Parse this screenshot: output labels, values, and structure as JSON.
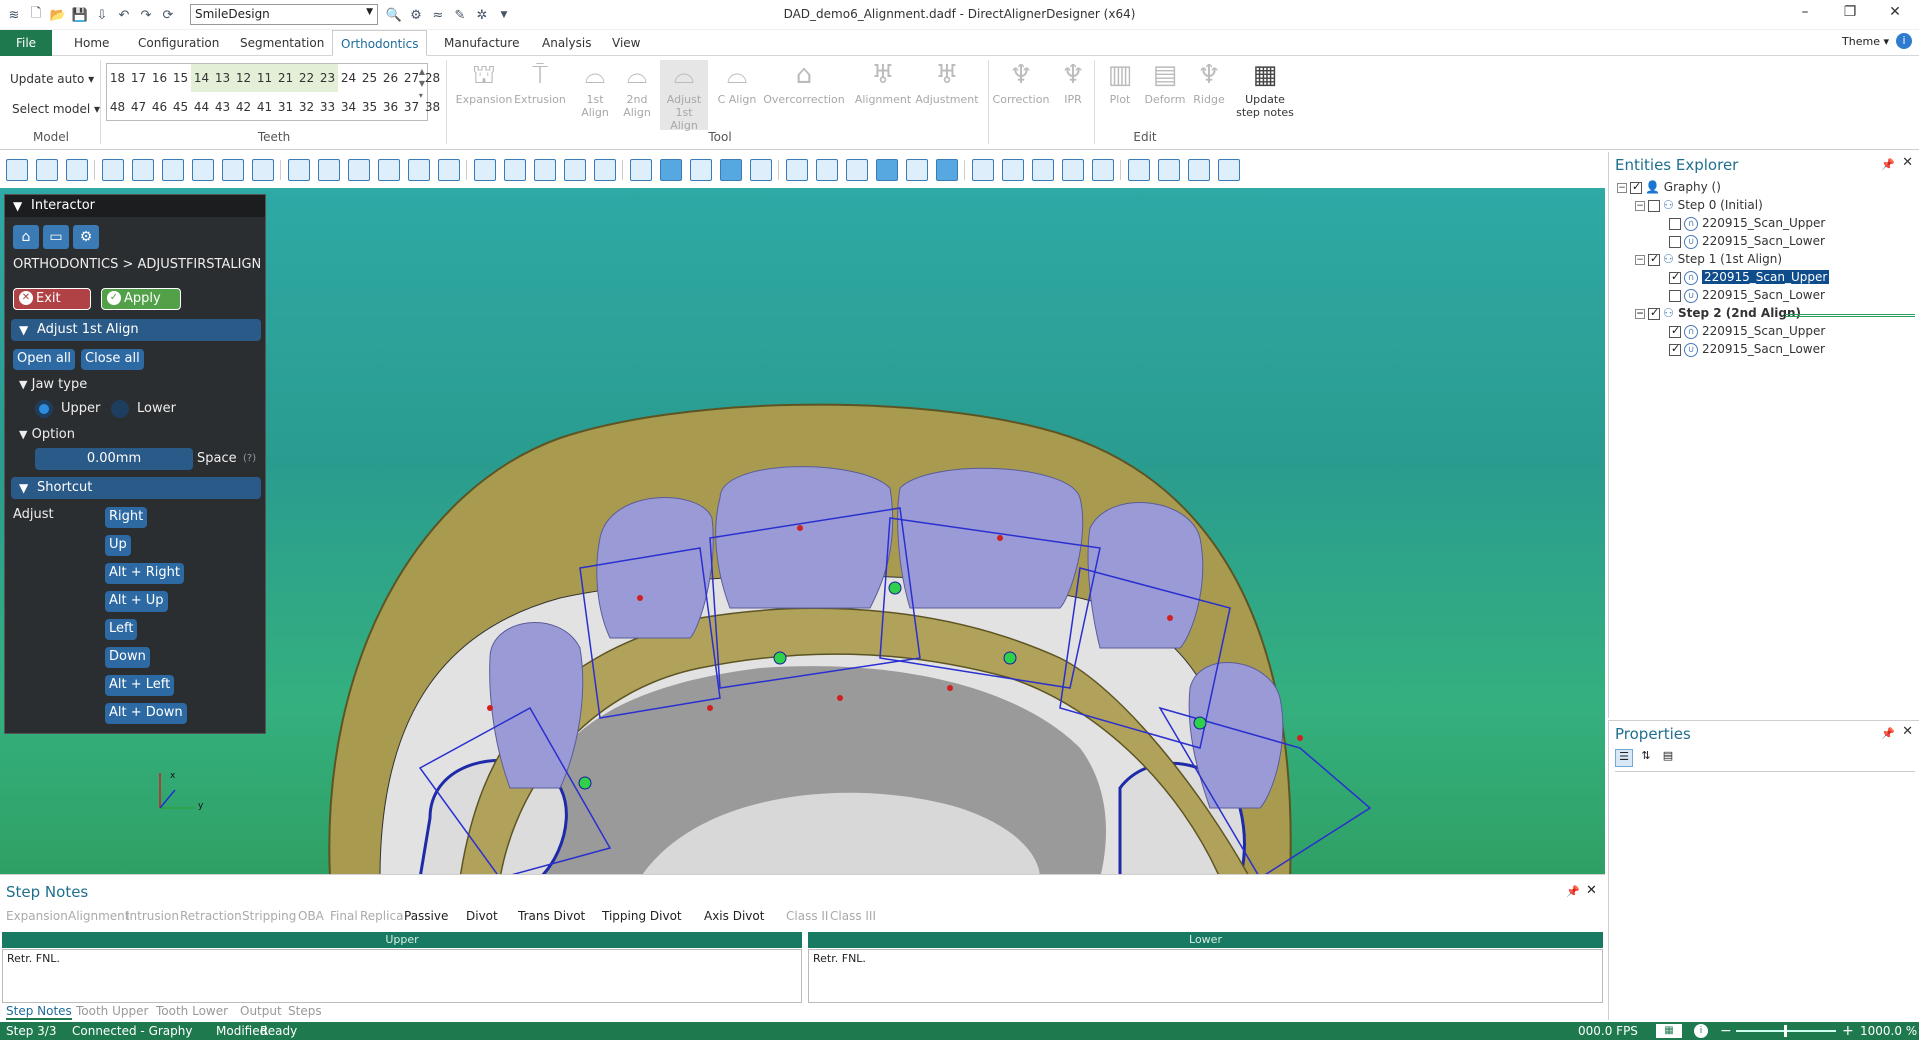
{
  "window": {
    "title": "DAD_demo6_Alignment.dadf - DirectAlignerDesigner (x64)",
    "profile": "SmileDesign",
    "theme": "Theme"
  },
  "menu": [
    "File",
    "Home",
    "Configuration",
    "Segmentation",
    "Orthodontics",
    "Manufacture",
    "Analysis",
    "View"
  ],
  "ribbon": {
    "model": {
      "update": "Update auto",
      "select": "Select model",
      "label": "Model"
    },
    "teeth": {
      "upper": [
        "18",
        "17",
        "16",
        "15",
        "14",
        "13",
        "12",
        "11",
        "21",
        "22",
        "23",
        "24",
        "25",
        "26",
        "27",
        "28"
      ],
      "lower": [
        "48",
        "47",
        "46",
        "45",
        "44",
        "43",
        "42",
        "41",
        "31",
        "32",
        "33",
        "34",
        "35",
        "36",
        "37",
        "38"
      ],
      "label": "Teeth"
    },
    "tools": [
      {
        "label": "Expansion"
      },
      {
        "label": "Extrusion"
      },
      {
        "label": "1st Align"
      },
      {
        "label": "2nd Align"
      },
      {
        "label": "Adjust 1st Align"
      },
      {
        "label": "C Align"
      },
      {
        "label": "Overcorrection"
      },
      {
        "label": "Alignment"
      },
      {
        "label": "Adjustment"
      }
    ],
    "tool_label": "Tool",
    "edit": [
      {
        "label": "Correction"
      },
      {
        "label": "IPR"
      },
      {
        "label": "Plot"
      },
      {
        "label": "Deform"
      },
      {
        "label": "Ridge"
      }
    ],
    "update_notes": "Update step notes",
    "edit_label": "Edit"
  },
  "interactor": {
    "title": "Interactor",
    "breadcrumb": "ORTHODONTICS > ADJUSTFIRSTALIGN",
    "exit": "Exit",
    "apply": "Apply",
    "section_adjust": "Adjust 1st Align",
    "open_all": "Open all",
    "close_all": "Close all",
    "jaw_type": "Jaw type",
    "upper": "Upper",
    "lower": "Lower",
    "option": "Option",
    "space_value": "0.00mm",
    "space_label": "Space",
    "help": "(?)",
    "shortcut": "Shortcut",
    "adjust_label": "Adjust",
    "shortcuts": [
      "Right",
      "Up",
      "Alt + Right",
      "Alt + Up",
      "Left",
      "Down",
      "Alt + Left",
      "Alt + Down"
    ]
  },
  "entities": {
    "title": "Entities Explorer",
    "root": "Graphy ()",
    "steps": [
      {
        "name": "Step 0 (Initial)",
        "items": [
          "220915_Scan_Upper",
          "220915_Sacn_Lower"
        ]
      },
      {
        "name": "Step 1 (1st Align)",
        "items": [
          "220915_Scan_Upper",
          "220915_Sacn_Lower"
        ]
      },
      {
        "name": "Step 2 (2nd Align)",
        "items": [
          "220915_Scan_Upper",
          "220915_Sacn_Lower"
        ]
      }
    ]
  },
  "properties": {
    "title": "Properties"
  },
  "stepnotes": {
    "title": "Step Notes",
    "chips": [
      "Expansion",
      "Alignment",
      "Intrusion",
      "Retraction",
      "Stripping",
      "OBA",
      "Final",
      "Replica",
      "Passive",
      "Divot",
      "Trans Divot",
      "Tipping Divot",
      "Axis Divot",
      "Class II",
      "Class III"
    ],
    "upper_head": "Upper",
    "lower_head": "Lower",
    "upper_text": "Retr. FNL.",
    "lower_text": "Retr. FNL.",
    "tabs": [
      "Step Notes",
      "Tooth Upper",
      "Tooth Lower",
      "Output",
      "Steps"
    ]
  },
  "status": {
    "step": "Step 3/3",
    "connection": "Connected - Graphy",
    "modified": "Modified",
    "ready": "Ready",
    "fps": "000.0 FPS",
    "zoom": "1000.0 %"
  },
  "colors": {
    "accent_green": "#1e7a4e",
    "interactor_bg": "#2b2e31",
    "section_blue": "#2a5a87",
    "viewport_teal": "#2ea9a5"
  }
}
